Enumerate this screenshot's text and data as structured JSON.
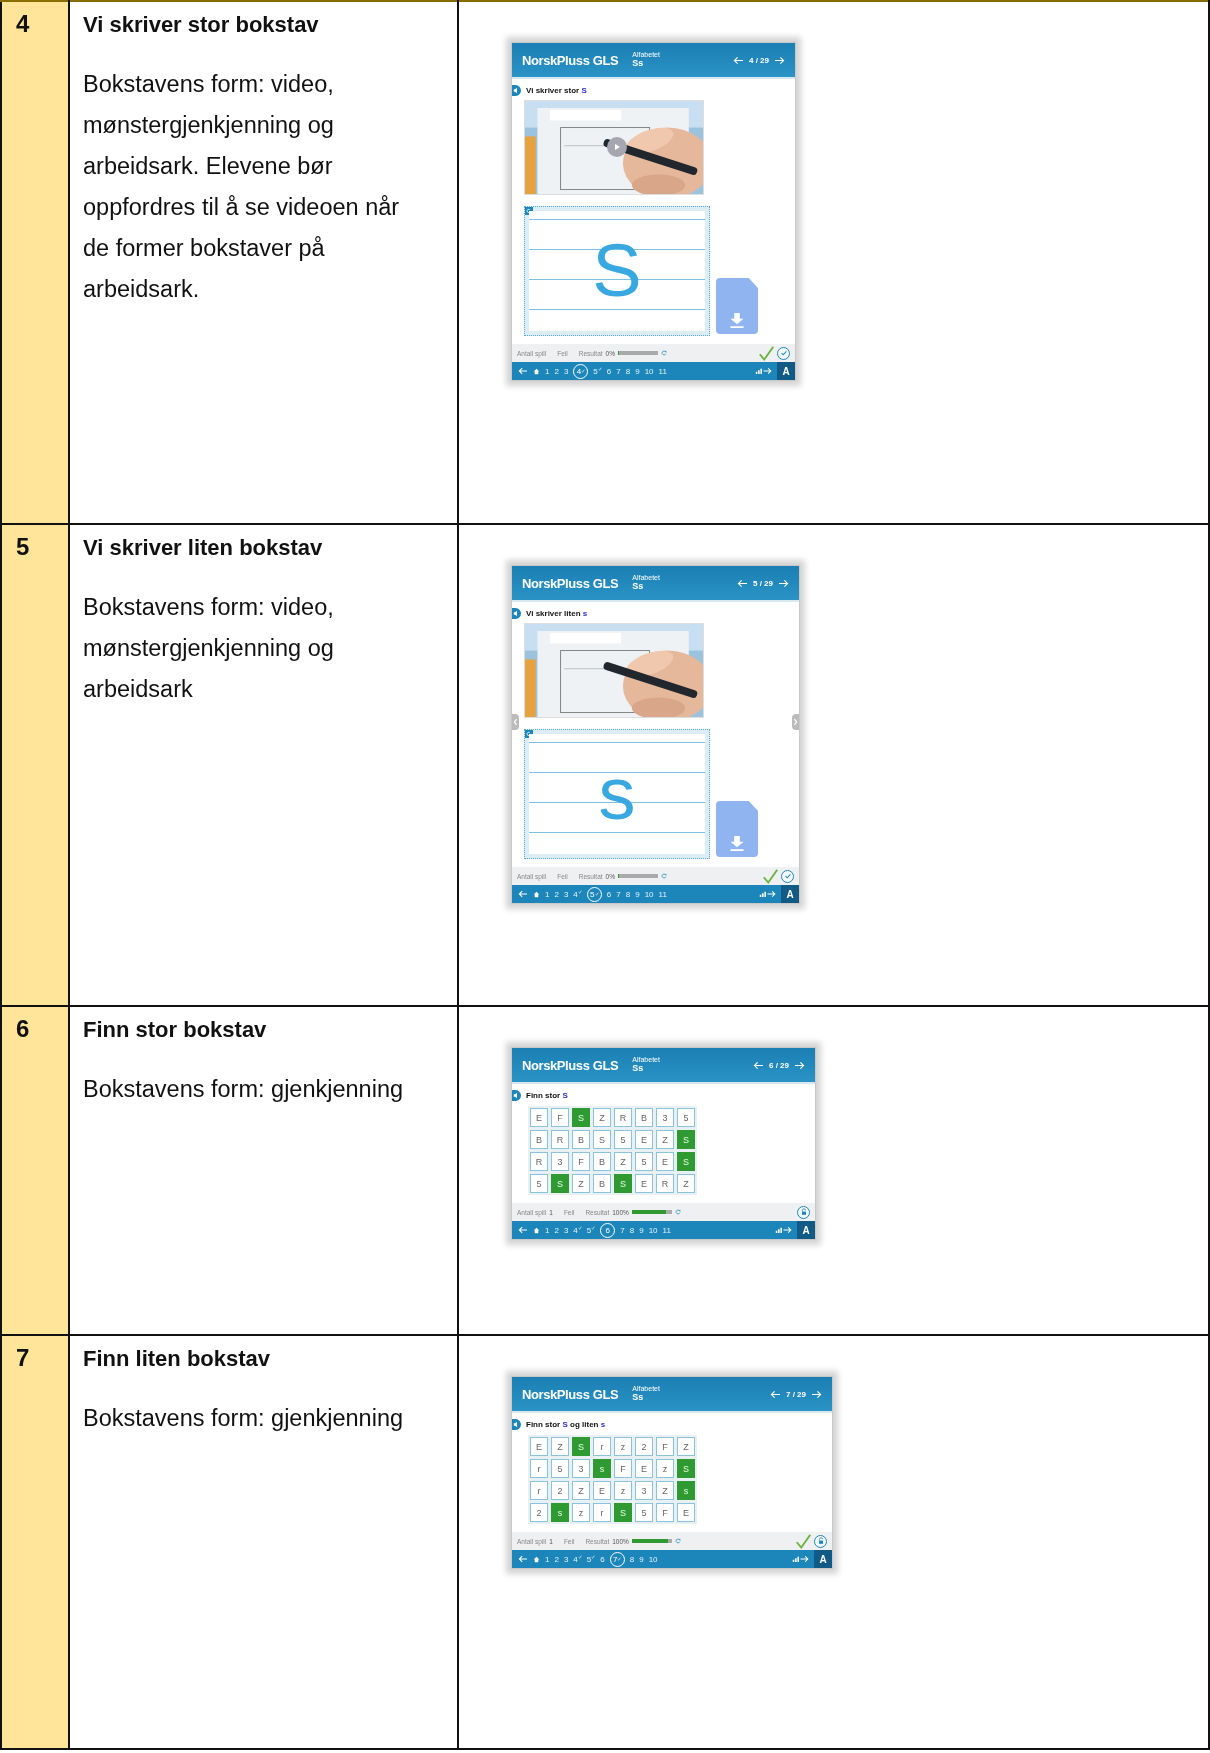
{
  "rows": [
    {
      "number": "4",
      "title": "Vi skriver stor bokstav",
      "description": "Bokstavens form: video, mønstergjenkjenning og arbeidsark. Elevene bør oppfordres til å se videoen når de former bokstaver på arbeidsark.",
      "screen": {
        "kind": "writing",
        "logo": "NorskPluss GLS",
        "subject": "Alfabetet",
        "letters": "Ss",
        "counter": "4 / 29",
        "heading": [
          {
            "text": "Vi skriver stor ",
            "highlight": false
          },
          {
            "text": "S",
            "highlight": true
          }
        ],
        "play_button": true,
        "side_arrows": false,
        "traced_letter": "S",
        "footer": {
          "games_label": "Antall spill",
          "errors_label": "Feil",
          "result_label": "Resultat",
          "result": "0%",
          "level": 0,
          "checkmark": true,
          "action": {
            "kind": "check"
          }
        },
        "nav": [
          {
            "label": "1",
            "done": false,
            "current": false
          },
          {
            "label": "2",
            "done": false,
            "current": false
          },
          {
            "label": "3",
            "done": false,
            "current": false
          },
          {
            "label": "4",
            "done": true,
            "current": true
          },
          {
            "label": "5",
            "done": true,
            "current": false
          },
          {
            "label": "6",
            "done": false,
            "current": false
          },
          {
            "label": "7",
            "done": false,
            "current": false
          },
          {
            "label": "8",
            "done": false,
            "current": false
          },
          {
            "label": "9",
            "done": false,
            "current": false
          },
          {
            "label": "10",
            "done": false,
            "current": false
          },
          {
            "label": "11",
            "done": false,
            "current": false
          }
        ],
        "font_button": "A"
      }
    },
    {
      "number": "5",
      "title": "Vi skriver liten bokstav",
      "description": "Bokstavens form: video, mønstergjenkjenning og arbeidsark",
      "screen": {
        "kind": "writing",
        "logo": "NorskPluss GLS",
        "subject": "Alfabetet",
        "letters": "Ss",
        "counter": "5 / 29",
        "heading": [
          {
            "text": "Vi skriver liten ",
            "highlight": false
          },
          {
            "text": "s",
            "highlight": true
          }
        ],
        "play_button": false,
        "side_arrows": true,
        "traced_letter": "s",
        "footer": {
          "games_label": "Antall spill",
          "errors_label": "Feil",
          "result_label": "Resultat",
          "result": "0%",
          "level": 0,
          "checkmark": true,
          "action": {
            "kind": "check"
          }
        },
        "nav": [
          {
            "label": "1",
            "done": false,
            "current": false
          },
          {
            "label": "2",
            "done": false,
            "current": false
          },
          {
            "label": "3",
            "done": false,
            "current": false
          },
          {
            "label": "4",
            "done": true,
            "current": false
          },
          {
            "label": "5",
            "done": true,
            "current": true
          },
          {
            "label": "6",
            "done": false,
            "current": false
          },
          {
            "label": "7",
            "done": false,
            "current": false
          },
          {
            "label": "8",
            "done": false,
            "current": false
          },
          {
            "label": "9",
            "done": false,
            "current": false
          },
          {
            "label": "10",
            "done": false,
            "current": false
          },
          {
            "label": "11",
            "done": false,
            "current": false
          }
        ],
        "font_button": "A"
      }
    },
    {
      "number": "6",
      "title": "Finn stor bokstav",
      "description": "Bokstavens form: gjenkjenning",
      "screen": {
        "kind": "grid",
        "logo": "NorskPluss GLS",
        "subject": "Alfabetet",
        "letters": "Ss",
        "counter": "6 / 29",
        "heading": [
          {
            "text": "Finn stor ",
            "highlight": false
          },
          {
            "text": "S",
            "highlight": true
          }
        ],
        "grid": [
          [
            {
              "text": "E",
              "selected": false
            },
            {
              "text": "F",
              "selected": false
            },
            {
              "text": "S",
              "selected": true
            },
            {
              "text": "Z",
              "selected": false
            },
            {
              "text": "R",
              "selected": false
            },
            {
              "text": "B",
              "selected": false
            },
            {
              "text": "3",
              "selected": false
            },
            {
              "text": "5",
              "selected": false
            }
          ],
          [
            {
              "text": "B",
              "selected": false
            },
            {
              "text": "R",
              "selected": false
            },
            {
              "text": "B",
              "selected": false
            },
            {
              "text": "S",
              "selected": false
            },
            {
              "text": "5",
              "selected": false
            },
            {
              "text": "E",
              "selected": false
            },
            {
              "text": "Z",
              "selected": false
            },
            {
              "text": "S",
              "selected": true
            }
          ],
          [
            {
              "text": "R",
              "selected": false
            },
            {
              "text": "3",
              "selected": false
            },
            {
              "text": "F",
              "selected": false
            },
            {
              "text": "B",
              "selected": false
            },
            {
              "text": "Z",
              "selected": false
            },
            {
              "text": "5",
              "selected": false
            },
            {
              "text": "E",
              "selected": false
            },
            {
              "text": "S",
              "selected": true
            }
          ],
          [
            {
              "text": "5",
              "selected": false
            },
            {
              "text": "S",
              "selected": true
            },
            {
              "text": "Z",
              "selected": false
            },
            {
              "text": "B",
              "selected": false
            },
            {
              "text": "S",
              "selected": true
            },
            {
              "text": "E",
              "selected": false
            },
            {
              "text": "R",
              "selected": false
            },
            {
              "text": "Z",
              "selected": false
            }
          ]
        ],
        "footer": {
          "games_label": "Antall spill",
          "games_value": "1",
          "errors_label": "Feil",
          "result_label": "Resultat",
          "result": "100%",
          "level": 0.85,
          "checkmark": false,
          "action": {
            "kind": "lock"
          }
        },
        "nav": [
          {
            "label": "1",
            "done": false,
            "current": false
          },
          {
            "label": "2",
            "done": false,
            "current": false
          },
          {
            "label": "3",
            "done": false,
            "current": false
          },
          {
            "label": "4",
            "done": true,
            "current": false
          },
          {
            "label": "5",
            "done": true,
            "current": false
          },
          {
            "label": "6",
            "done": false,
            "current": true
          },
          {
            "label": "7",
            "done": false,
            "current": false
          },
          {
            "label": "8",
            "done": false,
            "current": false
          },
          {
            "label": "9",
            "done": false,
            "current": false
          },
          {
            "label": "10",
            "done": false,
            "current": false
          },
          {
            "label": "11",
            "done": false,
            "current": false
          }
        ],
        "font_button": "A"
      }
    },
    {
      "number": "7",
      "title": "Finn liten bokstav",
      "description": "Bokstavens form: gjenkjenning",
      "screen": {
        "kind": "grid",
        "logo": "NorskPluss GLS",
        "subject": "Alfabetet",
        "letters": "Ss",
        "counter": "7 / 29",
        "heading": [
          {
            "text": "Finn stor ",
            "highlight": false
          },
          {
            "text": "S",
            "highlight": true
          },
          {
            "text": " og liten ",
            "highlight": false
          },
          {
            "text": "s",
            "highlight": true
          }
        ],
        "grid": [
          [
            {
              "text": "E",
              "selected": false
            },
            {
              "text": "Z",
              "selected": false
            },
            {
              "text": "S",
              "selected": true
            },
            {
              "text": "r",
              "selected": false
            },
            {
              "text": "z",
              "selected": false
            },
            {
              "text": "2",
              "selected": false
            },
            {
              "text": "F",
              "selected": false
            },
            {
              "text": "Z",
              "selected": false
            }
          ],
          [
            {
              "text": "r",
              "selected": false
            },
            {
              "text": "5",
              "selected": false
            },
            {
              "text": "3",
              "selected": false
            },
            {
              "text": "s",
              "selected": true
            },
            {
              "text": "F",
              "selected": false
            },
            {
              "text": "E",
              "selected": false
            },
            {
              "text": "z",
              "selected": false
            },
            {
              "text": "S",
              "selected": true
            }
          ],
          [
            {
              "text": "r",
              "selected": false
            },
            {
              "text": "2",
              "selected": false
            },
            {
              "text": "Z",
              "selected": false
            },
            {
              "text": "E",
              "selected": false
            },
            {
              "text": "z",
              "selected": false
            },
            {
              "text": "3",
              "selected": false
            },
            {
              "text": "Z",
              "selected": false
            },
            {
              "text": "s",
              "selected": true
            }
          ],
          [
            {
              "text": "2",
              "selected": false
            },
            {
              "text": "s",
              "selected": true
            },
            {
              "text": "z",
              "selected": false
            },
            {
              "text": "r",
              "selected": false
            },
            {
              "text": "S",
              "selected": true
            },
            {
              "text": "5",
              "selected": false
            },
            {
              "text": "F",
              "selected": false
            },
            {
              "text": "E",
              "selected": false
            }
          ]
        ],
        "footer": {
          "games_label": "Antall spill",
          "games_value": "1",
          "errors_label": "Feil",
          "result_label": "Resultat",
          "result": "100%",
          "level": 0.9,
          "checkmark": true,
          "action": {
            "kind": "lock"
          }
        },
        "nav": [
          {
            "label": "1",
            "done": false,
            "current": false
          },
          {
            "label": "2",
            "done": false,
            "current": false
          },
          {
            "label": "3",
            "done": false,
            "current": false
          },
          {
            "label": "4",
            "done": true,
            "current": false
          },
          {
            "label": "5",
            "done": true,
            "current": false
          },
          {
            "label": "6",
            "done": false,
            "current": false
          },
          {
            "label": "7",
            "done": true,
            "current": true
          },
          {
            "label": "8",
            "done": false,
            "current": false
          },
          {
            "label": "9",
            "done": false,
            "current": false
          },
          {
            "label": "10",
            "done": false,
            "current": false
          }
        ],
        "font_button": "A"
      }
    }
  ]
}
